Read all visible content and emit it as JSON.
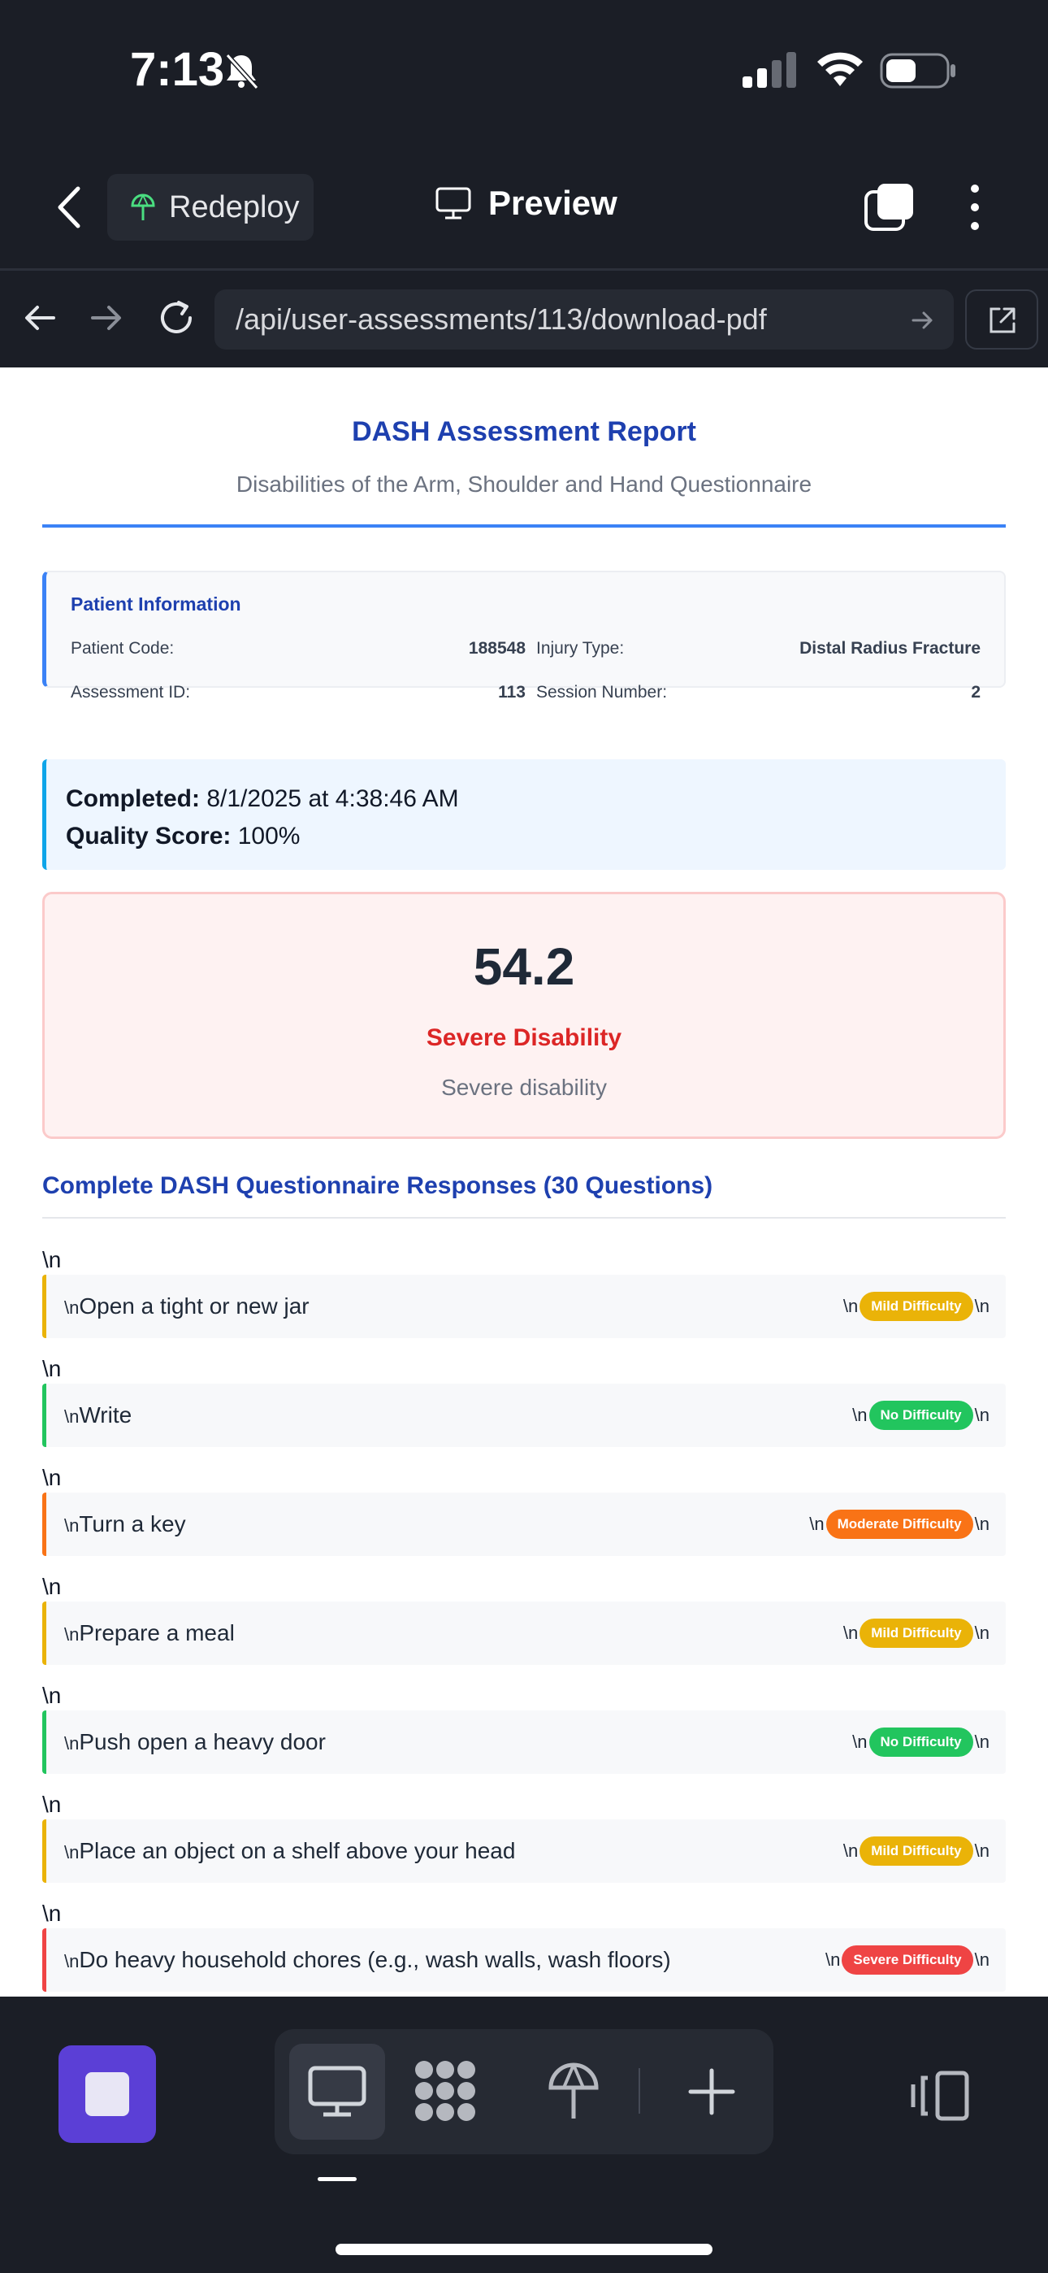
{
  "status_bar": {
    "time": "7:13"
  },
  "app_header": {
    "redeploy_label": "Redeploy",
    "preview_label": "Preview"
  },
  "browser": {
    "url": "/api/user-assessments/113/download-pdf"
  },
  "report": {
    "title": "DASH Assessment Report",
    "subtitle": "Disabilities of the Arm, Shoulder and Hand Questionnaire",
    "patient": {
      "heading": "Patient Information",
      "patient_code_label": "Patient Code:",
      "patient_code": "188548",
      "injury_type_label": "Injury Type:",
      "injury_type": "Distal Radius Fracture",
      "assessment_id_label": "Assessment ID:",
      "assessment_id": "113",
      "session_number_label": "Session Number:",
      "session_number": "2"
    },
    "completed_label": "Completed:",
    "completed_value": "8/1/2025 at 4:38:46 AM",
    "quality_label": "Quality Score:",
    "quality_value": "100%",
    "score": "54.2",
    "severity": "Severe Disability",
    "severity_desc": "Severe disability",
    "responses_title": "Complete DASH Questionnaire Responses (30 Questions)",
    "newline_marker": "\\n",
    "questions": [
      {
        "text": "Open a tight or new jar",
        "difficulty": "Mild Difficulty",
        "level": "mild",
        "color": "#eab308"
      },
      {
        "text": "Write",
        "difficulty": "No Difficulty",
        "level": "none",
        "color": "#22c55e"
      },
      {
        "text": "Turn a key",
        "difficulty": "Moderate Difficulty",
        "level": "moderate",
        "color": "#f97316"
      },
      {
        "text": "Prepare a meal",
        "difficulty": "Mild Difficulty",
        "level": "mild",
        "color": "#eab308"
      },
      {
        "text": "Push open a heavy door",
        "difficulty": "No Difficulty",
        "level": "none",
        "color": "#22c55e"
      },
      {
        "text": "Place an object on a shelf above your head",
        "difficulty": "Mild Difficulty",
        "level": "mild",
        "color": "#eab308"
      },
      {
        "text": "Do heavy household chores (e.g., wash walls, wash floors)",
        "difficulty": "Severe Difficulty",
        "level": "severe",
        "color": "#ef4444"
      }
    ]
  },
  "bottom_bar": {
    "icons": [
      "stop-icon",
      "desktop-icon",
      "apps-icon",
      "deploy-icon",
      "plus-icon",
      "split-view-icon"
    ]
  }
}
